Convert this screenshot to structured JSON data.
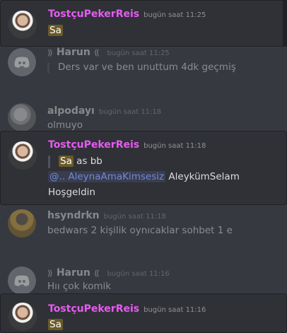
{
  "messages": [
    {
      "author": "TostçuPekerReis",
      "time": "bugün saat 11:25",
      "text": "Sa"
    },
    {
      "author": "Harun",
      "deco_left": "⟫",
      "deco_right": "⟪",
      "time": "bugün saat 11:25",
      "text": "Ders var ve ben unuttum 4dk geçmiş"
    },
    {
      "author": "alpodayı",
      "time": "bugün saat 11:18",
      "text": "olmuyo"
    },
    {
      "author": "TostçuPekerReis",
      "time": "bugün saat 11:18",
      "text_hl": "Sa",
      "text_rest": " as bb",
      "mention": "@.. AleynaAmaKimsesiz",
      "line2_rest": " AleykümSelam",
      "line3": "Hoşgeldin"
    },
    {
      "author": "hsyndrkn",
      "time": "bugün saat 11:18",
      "text": "bedwars 2 kişilik oynıcaklar sohbet 1 e"
    },
    {
      "author": "Harun",
      "deco_left": "⟫",
      "deco_right": "⟪",
      "time": "bugün saat 11:16",
      "text": "Hıı çok komik"
    },
    {
      "author": "TostçuPekerReis",
      "time": "bugün saat 11:16",
      "text": "Sa"
    }
  ],
  "colors": {
    "highlight_name": "#e65bf2",
    "mention": "#7289da",
    "bg": "#36393f",
    "hl_bg": "#2f3136"
  }
}
